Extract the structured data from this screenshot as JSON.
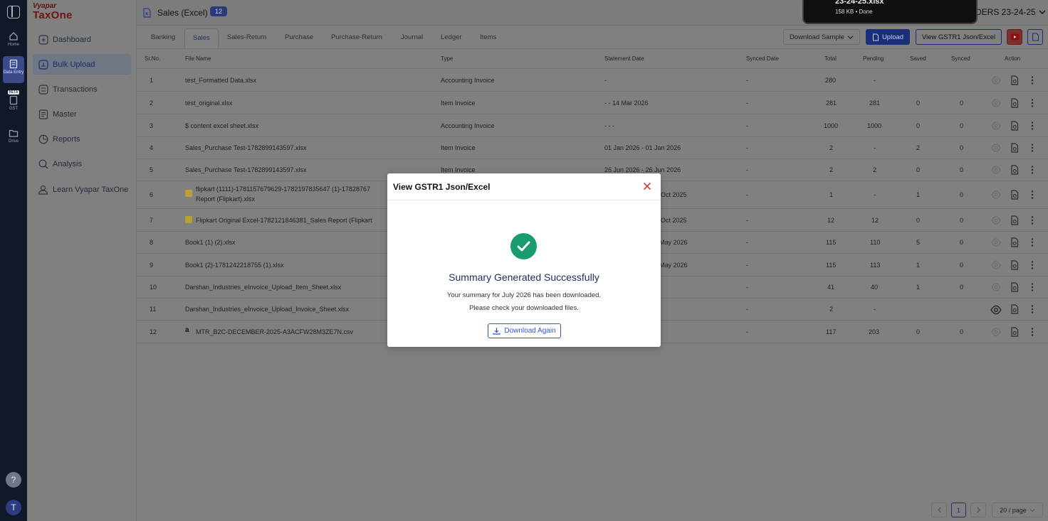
{
  "rail": {
    "items": [
      {
        "label": "Home"
      },
      {
        "label": "Data Entry"
      },
      {
        "label": "GST",
        "badge": "BETA"
      },
      {
        "label": "Drive"
      }
    ],
    "help": "?",
    "avatar": "T"
  },
  "sidebar": {
    "logo_top": "Vyapar",
    "logo_bottom": "TaxOne",
    "items": [
      {
        "label": "Dashboard",
        "icon": "grid-icon"
      },
      {
        "label": "Bulk Upload",
        "icon": "upload-icon"
      },
      {
        "label": "Transactions",
        "icon": "transactions-icon"
      },
      {
        "label": "Master",
        "icon": "master-icon"
      },
      {
        "label": "Reports",
        "icon": "reports-icon"
      },
      {
        "label": "Analysis",
        "icon": "analysis-icon"
      },
      {
        "label": "Learn Vyapar TaxOne",
        "icon": "learn-icon"
      }
    ]
  },
  "header": {
    "title": "Sales (Excel)",
    "count": "12",
    "company": "DERS 23-24-25"
  },
  "download_toast": {
    "filename": "23-24-25.xlsx",
    "status": "158 KB • Done"
  },
  "tabs": [
    "Banking",
    "Sales",
    "Sales-Return",
    "Purchase",
    "Purchase-Return",
    "Journal",
    "Ledger",
    "Items"
  ],
  "toolbar": {
    "download_sample": "Download Sample",
    "upload": "Upload",
    "view_gstr1": "View GSTR1 Json/Excel"
  },
  "columns": {
    "srno": "Sr.No.",
    "file": "File Name",
    "type": "Type",
    "stmt": "Statement Date",
    "synced_date": "Synced Date",
    "total": "Total",
    "pending": "Pending",
    "saved": "Saved",
    "synced": "Synced",
    "action": "Action"
  },
  "rows": [
    {
      "sr": "1",
      "file": "test_Formatted Data.xlsx",
      "type": "Accounting Invoice",
      "stmt": "-",
      "synced_date": "-",
      "total": "280",
      "pending": "-",
      "saved": "",
      "synced": ""
    },
    {
      "sr": "2",
      "file": "test_original.xlsx",
      "type": "Item Invoice",
      "stmt": "- - 14 Mar 2026",
      "synced_date": "-",
      "total": "281",
      "pending": "281",
      "saved": "0",
      "synced": "0"
    },
    {
      "sr": "3",
      "file": "$ content excel sheet.xlsx",
      "type": "Accounting Invoice",
      "stmt": "- - -",
      "synced_date": "-",
      "total": "1000",
      "pending": "1000",
      "saved": "0",
      "synced": "0"
    },
    {
      "sr": "4",
      "file": "Sales_Purchase Test-1782899143597.xlsx",
      "type": "Item Invoice",
      "stmt": "01 Jan 2026 - 01 Jan 2026",
      "synced_date": "-",
      "total": "2",
      "pending": "-",
      "saved": "2",
      "synced": "0"
    },
    {
      "sr": "5",
      "file": "Sales_Purchase Test-1782899143597.xlsx",
      "type": "Item Invoice",
      "stmt": "26 Jun 2026 - 26 Jun 2026",
      "synced_date": "-",
      "total": "2",
      "pending": "2",
      "saved": "0",
      "synced": "0"
    },
    {
      "sr": "6",
      "file": "flipkart (1111)-1781157679629-1782197835647 (1)-17828767",
      "file2": "Report (Flipkart).xlsx",
      "type": "",
      "stmt": "Oct 2025",
      "synced_date": "-",
      "total": "1",
      "pending": "-",
      "saved": "1",
      "synced": "0"
    },
    {
      "sr": "7",
      "file": "Flipkart Original Excel-1782121846381_Sales Report (Flipkart",
      "type": "",
      "stmt": "Oct 2025",
      "synced_date": "-",
      "total": "12",
      "pending": "12",
      "saved": "0",
      "synced": "0"
    },
    {
      "sr": "8",
      "file": "Book1 (1) (2).xlsx",
      "type": "",
      "stmt": "May 2026",
      "synced_date": "-",
      "total": "115",
      "pending": "110",
      "saved": "5",
      "synced": "0"
    },
    {
      "sr": "9",
      "file": "Book1 (2)-1781242218755 (1).xlsx",
      "type": "",
      "stmt": "May 2026",
      "synced_date": "-",
      "total": "115",
      "pending": "113",
      "saved": "1",
      "synced": "0"
    },
    {
      "sr": "10",
      "file": "Darshan_Industries_eInvoice_Upload_Item_Sheet.xlsx",
      "type": "",
      "stmt": "",
      "synced_date": "-",
      "total": "41",
      "pending": "40",
      "saved": "1",
      "synced": "0"
    },
    {
      "sr": "11",
      "file": "Darshan_Industries_eInvoice_Upload_Invoice_Sheet.xlsx",
      "type": "",
      "stmt": "",
      "synced_date": "-",
      "total": "2",
      "pending": "-",
      "saved": "",
      "synced": ""
    },
    {
      "sr": "12",
      "file": "MTR_B2C-DECEMBER-2025-A3ACFW28M3ZE7N.csv",
      "type": "",
      "stmt": "",
      "synced_date": "-",
      "total": "117",
      "pending": "203",
      "saved": "0",
      "synced": "0"
    }
  ],
  "modal": {
    "title": "View GSTR1 Json/Excel",
    "heading": "Summary Generated Successfully",
    "line1": "Your summary for July 2026 has been downloaded.",
    "line2": "Please check your downloaded files.",
    "button": "Download Again"
  },
  "pagination": {
    "page": "1",
    "page_size": "20 / page"
  },
  "colors": {
    "accent": "#2f54eb",
    "dark": "#111827",
    "success": "#1a9d6c",
    "youtube": "#e62117"
  }
}
